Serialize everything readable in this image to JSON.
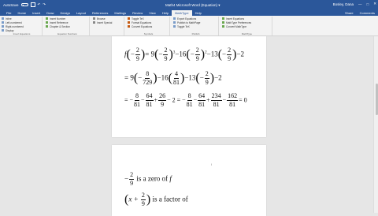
{
  "window": {
    "autosave_label": "AutoSave",
    "title": "Math4 Microsoft Word (Equation) ▾",
    "user": "Bosley, Dana",
    "share_label": "Share",
    "comments_label": "Comments"
  },
  "menu": {
    "tabs": [
      "File",
      "Home",
      "Insert",
      "Draw",
      "Design",
      "Layout",
      "References",
      "Mailings",
      "Review",
      "View",
      "Help",
      "MathType",
      "Help"
    ],
    "active_index": 11,
    "right_items": [
      "Share",
      "Comments"
    ]
  },
  "ribbon": {
    "groups": [
      {
        "label": "Insert Equations",
        "rows": [
          "Inline",
          "Left-numbered",
          "Right-numbered",
          "Display"
        ]
      },
      {
        "label": "Equation Numbers",
        "rows": [
          "Insert Number",
          "Insert Reference",
          "Chapter & Section"
        ]
      },
      {
        "label": "",
        "rows": [
          "Browse",
          "Insert Special"
        ]
      },
      {
        "label": "Symbols",
        "rows": [
          "Toggle TeX",
          "Format Equations",
          "Convert Equations"
        ]
      },
      {
        "label": "Publish",
        "rows": [
          "Export Equations",
          "Publish to MathPage",
          "Toggle TeX"
        ]
      },
      {
        "label": "MathType",
        "rows": [
          "Insert Equations",
          "MathType Preferences",
          "Convert MathType"
        ]
      }
    ]
  },
  "document": {
    "page1": {
      "line1": {
        "lhs": "f",
        "a_num": "2",
        "a_den": "9",
        "rest1": "= 9",
        "b_num": "2",
        "b_den": "9",
        "exp1": "3",
        "rest2": "−16",
        "c_num": "2",
        "c_den": "9",
        "exp2": "2",
        "rest3": "−13",
        "d_num": "2",
        "d_den": "9",
        "tail": "−2"
      },
      "line2": {
        "lead": "= 9",
        "a_num": "8",
        "a_den": "729",
        "mid1": "−16",
        "b_num": "4",
        "b_den": "81",
        "mid2": "−13",
        "c_num": "2",
        "c_den": "9",
        "tail": "−2"
      },
      "line3": {
        "lead": "= −",
        "f1n": "8",
        "f1d": "81",
        "op1": "−",
        "f2n": "64",
        "f2d": "81",
        "op2": "+",
        "f3n": "26",
        "f3d": "9",
        "op3": "− 2 = −",
        "f4n": "8",
        "f4d": "81",
        "op4": "−",
        "f5n": "64",
        "f5d": "81",
        "op5": "+",
        "f6n": "234",
        "f6d": "81",
        "op6": "−",
        "f7n": "162",
        "f7d": "81",
        "result": "= 0"
      }
    },
    "page2": {
      "zero_text": "is a zero of",
      "zero_f": "f",
      "zero_num": "2",
      "zero_den": "9",
      "factor_prefix": "x +",
      "factor_num": "2",
      "factor_den": "9",
      "factor_text": "is a factor of"
    }
  }
}
